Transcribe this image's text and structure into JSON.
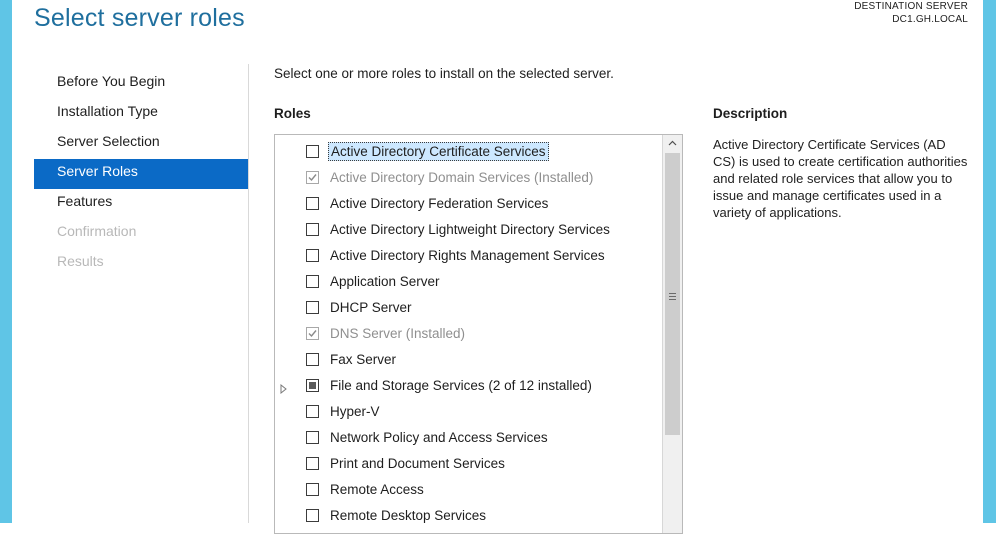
{
  "header": {
    "title": "Select server roles",
    "destination_label": "DESTINATION SERVER",
    "destination_server": "DC1.GH.LOCAL"
  },
  "nav": [
    {
      "label": "Before You Begin",
      "state": "normal"
    },
    {
      "label": "Installation Type",
      "state": "normal"
    },
    {
      "label": "Server Selection",
      "state": "normal"
    },
    {
      "label": "Server Roles",
      "state": "active"
    },
    {
      "label": "Features",
      "state": "normal"
    },
    {
      "label": "Confirmation",
      "state": "disabled"
    },
    {
      "label": "Results",
      "state": "disabled"
    }
  ],
  "main": {
    "instruction": "Select one or more roles to install on the selected server.",
    "roles_heading": "Roles",
    "description_heading": "Description",
    "description_text": "Active Directory Certificate Services (AD CS) is used to create certification authorities and related role services that allow you to issue and manage certificates used in a variety of applications."
  },
  "roles": [
    {
      "label": "Active Directory Certificate Services",
      "state": "unchecked",
      "selected": true,
      "installed": false,
      "expandable": false
    },
    {
      "label": "Active Directory Domain Services (Installed)",
      "state": "checked",
      "selected": false,
      "installed": true,
      "expandable": false
    },
    {
      "label": "Active Directory Federation Services",
      "state": "unchecked",
      "selected": false,
      "installed": false,
      "expandable": false
    },
    {
      "label": "Active Directory Lightweight Directory Services",
      "state": "unchecked",
      "selected": false,
      "installed": false,
      "expandable": false
    },
    {
      "label": "Active Directory Rights Management Services",
      "state": "unchecked",
      "selected": false,
      "installed": false,
      "expandable": false
    },
    {
      "label": "Application Server",
      "state": "unchecked",
      "selected": false,
      "installed": false,
      "expandable": false
    },
    {
      "label": "DHCP Server",
      "state": "unchecked",
      "selected": false,
      "installed": false,
      "expandable": false
    },
    {
      "label": "DNS Server (Installed)",
      "state": "checked",
      "selected": false,
      "installed": true,
      "expandable": false
    },
    {
      "label": "Fax Server",
      "state": "unchecked",
      "selected": false,
      "installed": false,
      "expandable": false
    },
    {
      "label": "File and Storage Services (2 of 12 installed)",
      "state": "partial",
      "selected": false,
      "installed": false,
      "expandable": true
    },
    {
      "label": "Hyper-V",
      "state": "unchecked",
      "selected": false,
      "installed": false,
      "expandable": false
    },
    {
      "label": "Network Policy and Access Services",
      "state": "unchecked",
      "selected": false,
      "installed": false,
      "expandable": false
    },
    {
      "label": "Print and Document Services",
      "state": "unchecked",
      "selected": false,
      "installed": false,
      "expandable": false
    },
    {
      "label": "Remote Access",
      "state": "unchecked",
      "selected": false,
      "installed": false,
      "expandable": false
    },
    {
      "label": "Remote Desktop Services",
      "state": "unchecked",
      "selected": false,
      "installed": false,
      "expandable": false
    }
  ],
  "icons": {
    "expander": "triangle-right-icon",
    "scroll_up": "chevron-up-icon",
    "scroll_grip": "grip-lines-icon"
  },
  "colors": {
    "accent": "#0b6ac6",
    "title": "#1f6f9e",
    "frame": "#5fc5e6",
    "selection": "#cde8ff"
  }
}
